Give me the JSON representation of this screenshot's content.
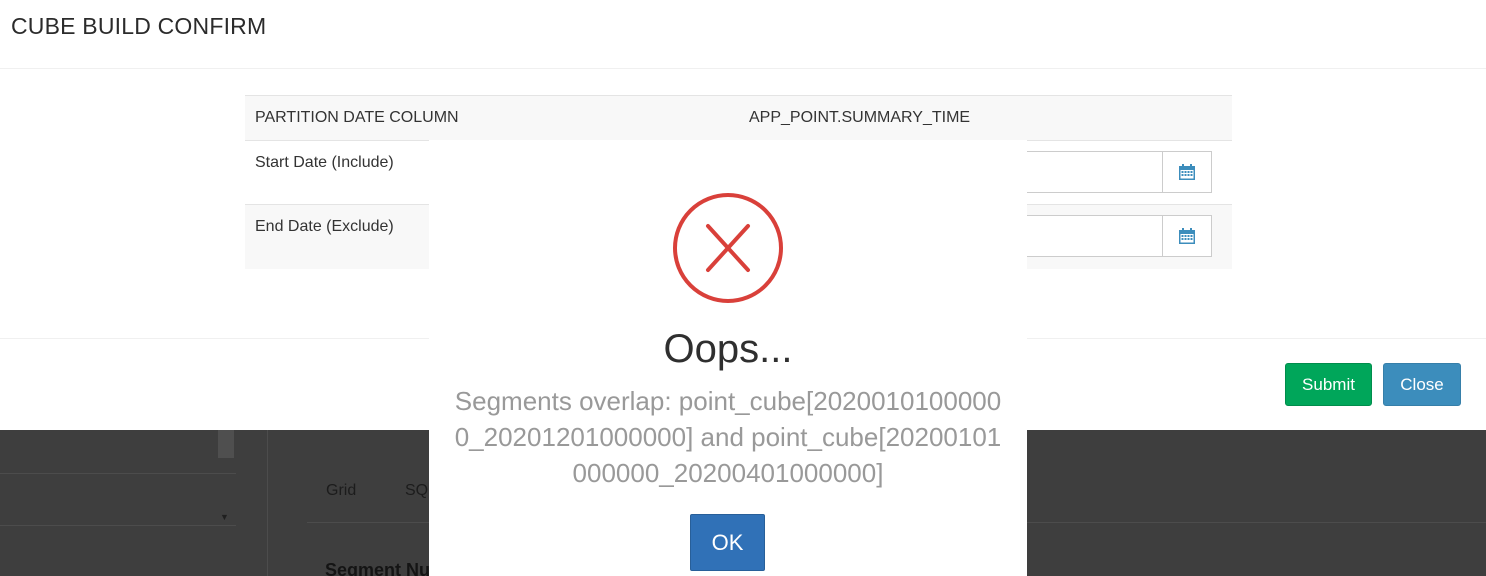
{
  "background": {
    "tabs": [
      "Grid",
      "SQ"
    ],
    "section_title": "Segment Nu"
  },
  "modal": {
    "title": "CUBE BUILD CONFIRM",
    "partition": {
      "label": "PARTITION DATE COLUMN",
      "value": "APP_POINT.SUMMARY_TIME"
    },
    "start_date": {
      "label": "Start Date (Include)",
      "value": ""
    },
    "end_date": {
      "label": "End Date (Exclude)",
      "value": ""
    },
    "buttons": {
      "submit": "Submit",
      "close": "Close"
    },
    "colors": {
      "submit": "#00a65a",
      "close": "#3c8dbc"
    }
  },
  "alert": {
    "icon": "error-x-icon",
    "title": "Oops...",
    "message": "Segments overlap: point_cube[20200101000000_20201201000000] and point_cube[20200101000000_20200401000000]",
    "ok_label": "OK",
    "colors": {
      "icon": "#d9403a",
      "ok": "#3071b7"
    }
  }
}
